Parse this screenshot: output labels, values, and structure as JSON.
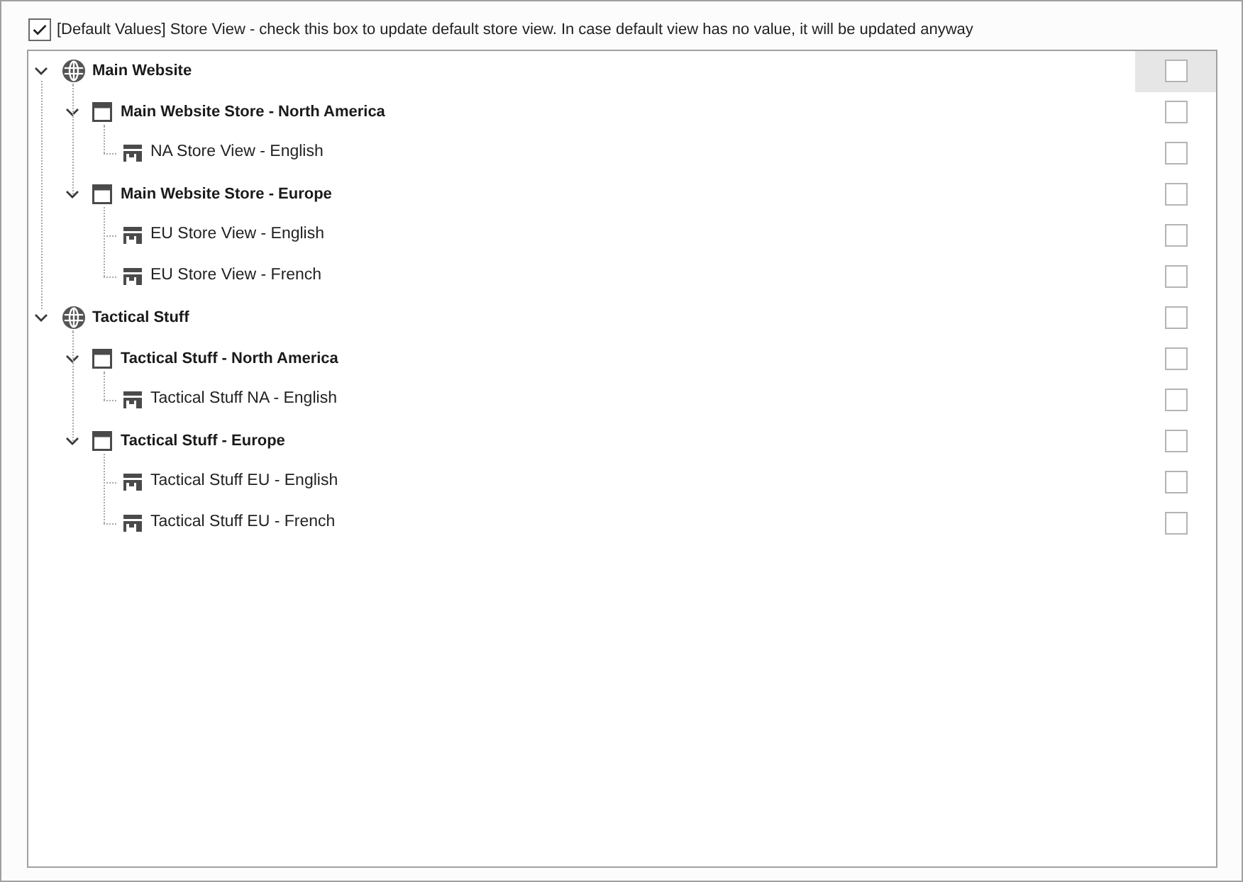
{
  "default_values_checkbox": {
    "label": "[Default Values] Store View - check this box to update default store view. In case default view has no value, it will be updated anyway",
    "checked": true
  },
  "tree": [
    {
      "kind": "website",
      "label": "Main Website",
      "expanded": true,
      "checked": false,
      "selected": true,
      "children": [
        {
          "kind": "store",
          "label": "Main Website Store - North America",
          "expanded": true,
          "checked": false,
          "selected": false,
          "children": [
            {
              "kind": "view",
              "label": "NA Store View - English",
              "checked": false,
              "selected": false
            }
          ]
        },
        {
          "kind": "store",
          "label": "Main Website Store - Europe",
          "expanded": true,
          "checked": false,
          "selected": false,
          "children": [
            {
              "kind": "view",
              "label": "EU Store View - English",
              "checked": false,
              "selected": false
            },
            {
              "kind": "view",
              "label": "EU Store View - French",
              "checked": false,
              "selected": false
            }
          ]
        }
      ]
    },
    {
      "kind": "website",
      "label": "Tactical Stuff",
      "expanded": true,
      "checked": false,
      "selected": false,
      "children": [
        {
          "kind": "store",
          "label": "Tactical Stuff - North America",
          "expanded": true,
          "checked": false,
          "selected": false,
          "children": [
            {
              "kind": "view",
              "label": "Tactical Stuff NA - English",
              "checked": false,
              "selected": false
            }
          ]
        },
        {
          "kind": "store",
          "label": "Tactical Stuff - Europe",
          "expanded": true,
          "checked": false,
          "selected": false,
          "children": [
            {
              "kind": "view",
              "label": "Tactical Stuff EU - English",
              "checked": false,
              "selected": false
            },
            {
              "kind": "view",
              "label": "Tactical Stuff EU - French",
              "checked": false,
              "selected": false
            }
          ]
        }
      ]
    }
  ]
}
